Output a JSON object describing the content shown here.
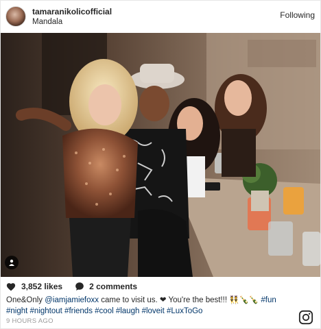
{
  "header": {
    "username": "tamaranikolicofficial",
    "location": "Mandala",
    "follow_label": "Following"
  },
  "post": {
    "likes": "3,852 likes",
    "comments": "2 comments",
    "caption_lead": "One&Only ",
    "mention": "@iamjamiefoxx",
    "caption_mid": " came to visit us. ❤ You're the best!!! 👯🍾🍾 ",
    "hashtags_line1": "#fun",
    "hashtags_line2": "#night #nightout #friends #cool #laugh #loveit #LuxToGo",
    "timestamp": "9 HOURS AGO"
  },
  "icons": {
    "like": "heart-icon",
    "comment": "comment-bubble-icon",
    "tag": "user-tag-icon",
    "brand": "instagram-logo-icon"
  },
  "colors": {
    "link": "#003569",
    "muted": "#999999",
    "text": "#262626"
  }
}
